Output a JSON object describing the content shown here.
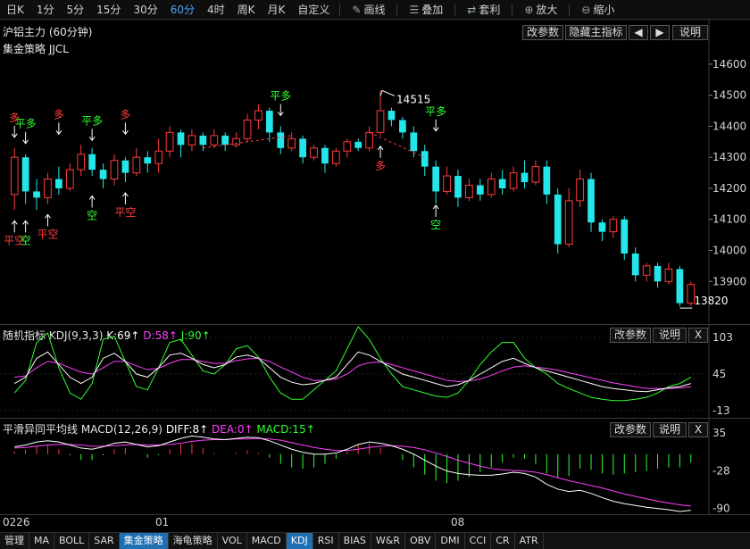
{
  "toolbar": {
    "periods": [
      "日K",
      "1分",
      "5分",
      "15分",
      "30分",
      "60分",
      "4时",
      "周K",
      "月K",
      "自定义"
    ],
    "active_period": "60分",
    "tools": [
      {
        "icon": "pencil-icon",
        "label": "画线"
      },
      {
        "icon": "layers-icon",
        "label": "叠加"
      },
      {
        "icon": "arbitrage-icon",
        "label": "套利"
      },
      {
        "icon": "zoom-in-icon",
        "label": "放大"
      },
      {
        "icon": "zoom-out-icon",
        "label": "缩小"
      }
    ]
  },
  "main_panel": {
    "title": "沪铝主力 (60分钟)",
    "strategy": "集金策略 JJCL",
    "buttons": {
      "params": "改参数",
      "hide": "隐藏主指标",
      "left": "◀",
      "right": "▶",
      "help": "说明"
    },
    "price_ticks": [
      "14600",
      "14500",
      "14400",
      "14300",
      "14200",
      "14100",
      "14000",
      "13900"
    ],
    "high_label": "14515",
    "low_label": "13820"
  },
  "signals": {
    "duo": "多",
    "kong": "空",
    "ping_duo": "平多",
    "ping_kong": "平空"
  },
  "kdj_panel": {
    "name": "随机指标",
    "params": "KDJ(9,3,3)",
    "k": "K:69↑",
    "d": "D:58↑",
    "j": "J:90↑",
    "ticks": [
      "103",
      "45",
      "-13"
    ],
    "buttons": {
      "params": "改参数",
      "help": "说明",
      "close": "X"
    }
  },
  "macd_panel": {
    "name": "平滑异同平均线",
    "params": "MACD(12,26,9)",
    "diff": "DIFF:8↑",
    "dea": "DEA:0↑",
    "macd": "MACD:15↑",
    "ticks": [
      "35",
      "-28",
      "-90"
    ],
    "buttons": {
      "params": "改参数",
      "help": "说明",
      "close": "X"
    }
  },
  "time_axis": [
    "0226",
    "01",
    "08"
  ],
  "bottom_tabs": [
    "管理",
    "MA",
    "BOLL",
    "SAR",
    "集金策略",
    "海龟策略",
    "VOL",
    "MACD",
    "KDJ",
    "RSI",
    "BIAS",
    "W&R",
    "OBV",
    "DMI",
    "CCI",
    "CR",
    "ATR"
  ],
  "active_tabs": [
    "集金策略",
    "KDJ"
  ],
  "colors": {
    "up": "#ff3b3b",
    "down": "#24e6ea",
    "kdj_k": "#ffffff",
    "kdj_d": "#ff40ff",
    "kdj_j": "#30ff30",
    "macd_pos": "#ff3b3b",
    "macd_neg": "#30ff30"
  },
  "chart_data": {
    "type": "candlestick",
    "instrument": "沪铝主力",
    "period": "60分钟",
    "ylim": [
      13780,
      14640
    ],
    "candles": [
      [
        14180,
        14300,
        14130,
        14330
      ],
      [
        14300,
        14190,
        14150,
        14310
      ],
      [
        14190,
        14170,
        14130,
        14230
      ],
      [
        14170,
        14230,
        14150,
        14250
      ],
      [
        14230,
        14200,
        14180,
        14270
      ],
      [
        14200,
        14260,
        14190,
        14280
      ],
      [
        14260,
        14310,
        14240,
        14340
      ],
      [
        14310,
        14260,
        14240,
        14330
      ],
      [
        14260,
        14230,
        14200,
        14280
      ],
      [
        14230,
        14290,
        14210,
        14310
      ],
      [
        14290,
        14250,
        14220,
        14300
      ],
      [
        14250,
        14300,
        14240,
        14330
      ],
      [
        14300,
        14280,
        14250,
        14320
      ],
      [
        14280,
        14320,
        14250,
        14360
      ],
      [
        14320,
        14380,
        14300,
        14400
      ],
      [
        14380,
        14340,
        14300,
        14390
      ],
      [
        14340,
        14370,
        14320,
        14390
      ],
      [
        14370,
        14340,
        14320,
        14380
      ],
      [
        14340,
        14370,
        14330,
        14390
      ],
      [
        14370,
        14340,
        14320,
        14380
      ],
      [
        14340,
        14360,
        14330,
        14380
      ],
      [
        14360,
        14420,
        14350,
        14440
      ],
      [
        14420,
        14450,
        14390,
        14470
      ],
      [
        14450,
        14380,
        14350,
        14460
      ],
      [
        14380,
        14330,
        14310,
        14400
      ],
      [
        14330,
        14360,
        14320,
        14380
      ],
      [
        14360,
        14300,
        14280,
        14370
      ],
      [
        14300,
        14330,
        14290,
        14340
      ],
      [
        14330,
        14280,
        14250,
        14340
      ],
      [
        14280,
        14320,
        14270,
        14330
      ],
      [
        14320,
        14350,
        14300,
        14360
      ],
      [
        14350,
        14330,
        14320,
        14360
      ],
      [
        14330,
        14380,
        14320,
        14400
      ],
      [
        14380,
        14450,
        14370,
        14515
      ],
      [
        14450,
        14420,
        14400,
        14460
      ],
      [
        14420,
        14380,
        14360,
        14430
      ],
      [
        14380,
        14320,
        14300,
        14400
      ],
      [
        14320,
        14270,
        14240,
        14340
      ],
      [
        14270,
        14190,
        14150,
        14290
      ],
      [
        14190,
        14240,
        14180,
        14270
      ],
      [
        14240,
        14170,
        14140,
        14260
      ],
      [
        14170,
        14210,
        14160,
        14230
      ],
      [
        14210,
        14180,
        14160,
        14230
      ],
      [
        14180,
        14230,
        14170,
        14250
      ],
      [
        14230,
        14200,
        14180,
        14260
      ],
      [
        14200,
        14250,
        14190,
        14270
      ],
      [
        14250,
        14220,
        14200,
        14290
      ],
      [
        14220,
        14270,
        14210,
        14290
      ],
      [
        14270,
        14180,
        14150,
        14290
      ],
      [
        14180,
        14020,
        13990,
        14200
      ],
      [
        14020,
        14160,
        14010,
        14200
      ],
      [
        14160,
        14230,
        14140,
        14260
      ],
      [
        14230,
        14090,
        14060,
        14250
      ],
      [
        14090,
        14060,
        14030,
        14100
      ],
      [
        14060,
        14100,
        14040,
        14110
      ],
      [
        14100,
        13990,
        13970,
        14110
      ],
      [
        13990,
        13920,
        13900,
        14010
      ],
      [
        13920,
        13950,
        13900,
        13960
      ],
      [
        13950,
        13900,
        13880,
        13960
      ],
      [
        13900,
        13940,
        13890,
        13960
      ],
      [
        13940,
        13830,
        13820,
        13950
      ],
      [
        13830,
        13890,
        13820,
        13900
      ]
    ],
    "kdj": {
      "K": [
        30,
        40,
        70,
        80,
        60,
        40,
        30,
        40,
        70,
        78,
        65,
        45,
        40,
        55,
        75,
        78,
        70,
        60,
        55,
        60,
        72,
        75,
        70,
        55,
        40,
        32,
        28,
        30,
        35,
        40,
        60,
        80,
        75,
        65,
        55,
        45,
        40,
        35,
        30,
        25,
        28,
        35,
        45,
        55,
        65,
        70,
        62,
        55,
        50,
        45,
        40,
        35,
        30,
        25,
        22,
        20,
        18,
        17,
        20,
        23,
        25,
        30
      ],
      "D": [
        40,
        42,
        55,
        65,
        62,
        55,
        48,
        45,
        55,
        65,
        65,
        58,
        52,
        54,
        62,
        68,
        68,
        65,
        62,
        62,
        66,
        69,
        70,
        65,
        56,
        48,
        40,
        35,
        35,
        37,
        45,
        58,
        63,
        64,
        60,
        55,
        50,
        45,
        40,
        35,
        33,
        34,
        37,
        43,
        50,
        56,
        58,
        56,
        54,
        51,
        47,
        43,
        39,
        35,
        31,
        28,
        25,
        22,
        22,
        22,
        23,
        25
      ],
      "J": [
        15,
        35,
        95,
        110,
        55,
        15,
        5,
        30,
        100,
        105,
        65,
        25,
        20,
        55,
        95,
        100,
        75,
        50,
        45,
        60,
        85,
        90,
        72,
        40,
        15,
        5,
        5,
        20,
        35,
        50,
        85,
        120,
        100,
        70,
        45,
        25,
        20,
        15,
        10,
        8,
        15,
        35,
        60,
        80,
        95,
        95,
        70,
        55,
        45,
        30,
        22,
        15,
        8,
        5,
        3,
        3,
        5,
        8,
        15,
        25,
        30,
        40
      ]
    },
    "macd": {
      "DIFF": [
        12,
        15,
        20,
        22,
        20,
        15,
        10,
        8,
        12,
        18,
        20,
        16,
        12,
        14,
        20,
        26,
        30,
        28,
        25,
        24,
        26,
        28,
        27,
        22,
        15,
        8,
        3,
        0,
        0,
        2,
        8,
        16,
        20,
        18,
        14,
        8,
        0,
        -10,
        -20,
        -28,
        -32,
        -34,
        -35,
        -35,
        -33,
        -30,
        -32,
        -38,
        -50,
        -58,
        -62,
        -60,
        -65,
        -72,
        -78,
        -82,
        -85,
        -88,
        -90,
        -92,
        -95,
        -93
      ],
      "DEA": [
        10,
        11,
        13,
        15,
        16,
        16,
        15,
        13,
        13,
        14,
        15,
        16,
        15,
        15,
        16,
        18,
        21,
        23,
        24,
        24,
        25,
        25,
        26,
        25,
        23,
        19,
        15,
        11,
        8,
        6,
        6,
        8,
        11,
        13,
        14,
        13,
        11,
        7,
        2,
        -4,
        -10,
        -15,
        -20,
        -24,
        -26,
        -27,
        -28,
        -30,
        -34,
        -39,
        -44,
        -48,
        -52,
        -56,
        -61,
        -66,
        -70,
        -74,
        -78,
        -81,
        -84,
        -86
      ],
      "MACD": [
        4,
        8,
        14,
        14,
        8,
        -2,
        -10,
        -10,
        -2,
        8,
        10,
        0,
        -6,
        -2,
        8,
        16,
        18,
        10,
        2,
        0,
        2,
        6,
        2,
        -6,
        -16,
        -22,
        -24,
        -22,
        -16,
        -8,
        4,
        16,
        18,
        10,
        0,
        -10,
        -22,
        -34,
        -44,
        -48,
        -44,
        -38,
        -30,
        -22,
        -14,
        -6,
        -8,
        -16,
        -32,
        -38,
        -36,
        -24,
        -26,
        -32,
        -34,
        -32,
        -30,
        -28,
        -24,
        -22,
        -22,
        -14
      ]
    }
  }
}
